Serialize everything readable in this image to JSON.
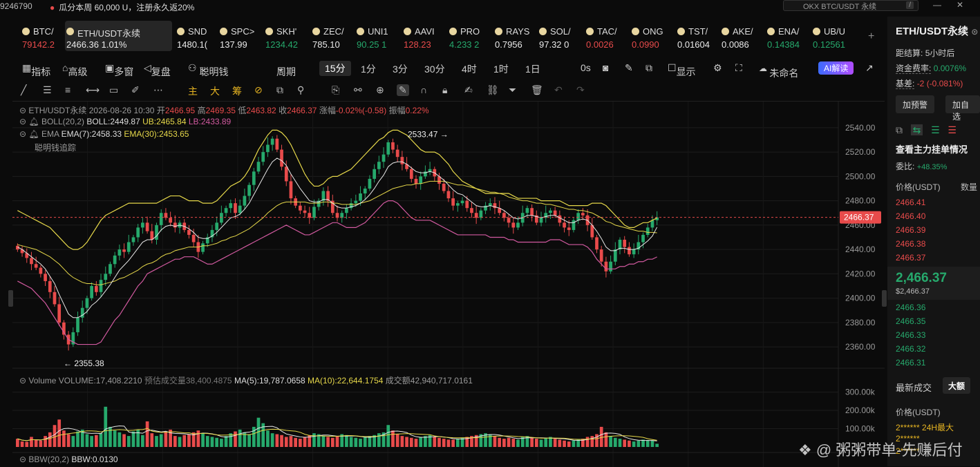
{
  "topbar": {
    "account_fragment": "9246790",
    "promo": "瓜分本周 60,000 U，注册永久返20%",
    "search_placeholder": "OKX BTC/USDT 永续",
    "search_shortcut": "/",
    "window_minimize": "—",
    "window_close": "✕"
  },
  "tickers": [
    {
      "symbol": "BTC/",
      "price": "79142.2",
      "trend": "down"
    },
    {
      "symbol": "ETH/USDT永续",
      "price": "2466.36  1.01%",
      "trend": "neutral",
      "active": true
    },
    {
      "symbol": "SND",
      "price": "1480.1(",
      "trend": "neutral"
    },
    {
      "symbol": "SPC>",
      "price": "137.99",
      "trend": "neutral"
    },
    {
      "symbol": "SKH'",
      "price": "1234.42",
      "trend": "up"
    },
    {
      "symbol": "ZEC/",
      "price": "785.10",
      "trend": "neutral"
    },
    {
      "symbol": "UNI1",
      "price": "90.25  1",
      "trend": "up"
    },
    {
      "symbol": "AAVI",
      "price": "128.23",
      "trend": "down"
    },
    {
      "symbol": "PRO",
      "price": "4.233  2",
      "trend": "up"
    },
    {
      "symbol": "RAYS",
      "price": "0.7956",
      "trend": "neutral"
    },
    {
      "symbol": "SOL/",
      "price": "97.32  0",
      "trend": "neutral"
    },
    {
      "symbol": "TAC/",
      "price": "0.0026",
      "trend": "down"
    },
    {
      "symbol": "ONG",
      "price": "0.0990",
      "trend": "down"
    },
    {
      "symbol": "TST/",
      "price": "0.01604",
      "trend": "neutral"
    },
    {
      "symbol": "AKE/",
      "price": "0.0086",
      "trend": "neutral"
    },
    {
      "symbol": "ENA/",
      "price": "0.14384",
      "trend": "up"
    },
    {
      "symbol": "UB/U",
      "price": "0.12561",
      "trend": "up"
    }
  ],
  "add_ticker": "+",
  "toolbar1": {
    "items": [
      "指标",
      "高级",
      "多窗",
      "复盘",
      "聪明钱",
      "周期"
    ],
    "intervals": [
      "15分",
      "1分",
      "3分",
      "30分",
      "4时",
      "1时",
      "1日"
    ],
    "active_interval": "15分",
    "countdown": "0s",
    "display": "显示",
    "layout_name": "未命名",
    "ai_button": "AI解读"
  },
  "toolbar2": {
    "tags": [
      "主",
      "大",
      "筹"
    ]
  },
  "chart_legend": {
    "symbol_line": "ETH/USDT永续  2026-08-26 10:30",
    "open_label": "开",
    "open": "2466.95",
    "high_label": "高",
    "high": "2469.35",
    "low_label": "低",
    "low": "2463.82",
    "close_label": "收",
    "close": "2466.37",
    "change_label": "涨幅",
    "change": "-0.02%(-0.58)",
    "amplitude_label": "振幅",
    "amplitude": "0.22%",
    "boll_name": "BOLL(20,2)",
    "boll": "BOLL:2449.87",
    "ub": "UB:2465.84",
    "lb": "LB:2433.89",
    "ema_name": "EMA",
    "ema7": "EMA(7):2458.33",
    "ema30": "EMA(30):2453.65",
    "smart_money": "聪明钱追踪"
  },
  "chart_annotations": {
    "high_mark": "2533.47 →",
    "low_mark": "← 2355.38",
    "current_price": "2466.37"
  },
  "volume_legend": {
    "name": "Volume",
    "volume": "VOLUME:17,408.2210",
    "est_label": "预估成交量",
    "est": "38,400.4875",
    "ma5": "MA(5):19,787.0658",
    "ma10": "MA(10):22,644.1754",
    "turnover_label": "成交额",
    "turnover": "42,940,717.0161"
  },
  "bbw_legend": {
    "name": "BBW(20,2)",
    "value": "BBW:0.0130"
  },
  "side": {
    "title": "ETH/USDT永续",
    "settle_label": "距结算:",
    "settle": "5小时后",
    "funding_label": "资金费率:",
    "funding": "0.0076%",
    "basis_label": "基差:",
    "basis": "-2 (-0.081%)",
    "alert_btn": "加预警",
    "fav_btn": "加自选",
    "orderbook_title": "查看主力挂单情况",
    "ratio_label": "委比:",
    "ratio": "+48.35%",
    "price_header": "价格(USDT)",
    "qty_header": "数量",
    "asks": [
      "2466.41",
      "2466.40",
      "2466.39",
      "2466.38",
      "2466.37"
    ],
    "last_price": "2,466.37",
    "last_price_usd": "$2,466.37",
    "bids": [
      "2466.36",
      "2466.35",
      "2466.33",
      "2466.32",
      "2466.31"
    ],
    "trades_title": "最新成交",
    "trades_tab": "大额",
    "trades_price_header": "价格(USDT)",
    "trade_rows": [
      "2****** 24H最大",
      "2******",
      "2******"
    ]
  },
  "watermark": "粥粥带单-先赚后付",
  "chart_data": {
    "type": "candlestick",
    "title": "ETH/USDT永续",
    "interval": "15分",
    "price_axis": {
      "ticks": [
        2540.0,
        2520.0,
        2500.0,
        2480.0,
        2460.0,
        2440.0,
        2420.0,
        2400.0,
        2380.0,
        2360.0
      ],
      "range": [
        2347,
        2549
      ]
    },
    "volume_axis": {
      "ticks": [
        "300.00k",
        "200.00k",
        "100.00k"
      ],
      "range": [
        0,
        340000
      ]
    },
    "high": 2533.47,
    "low": 2355.38,
    "last": 2466.37,
    "closes": [
      2440,
      2437,
      2433,
      2428,
      2425,
      2420,
      2414,
      2405,
      2395,
      2380,
      2370,
      2362,
      2372,
      2384,
      2392,
      2400,
      2410,
      2405,
      2415,
      2420,
      2428,
      2435,
      2440,
      2438,
      2446,
      2450,
      2458,
      2462,
      2455,
      2448,
      2460,
      2470,
      2466,
      2462,
      2458,
      2462,
      2456,
      2452,
      2446,
      2438,
      2445,
      2450,
      2456,
      2462,
      2470,
      2474,
      2478,
      2470,
      2476,
      2484,
      2493,
      2504,
      2512,
      2520,
      2526,
      2531,
      2522,
      2508,
      2496,
      2482,
      2476,
      2472,
      2470,
      2466,
      2475,
      2480,
      2488,
      2480,
      2470,
      2466,
      2470,
      2474,
      2478,
      2480,
      2486,
      2490,
      2498,
      2506,
      2512,
      2518,
      2528,
      2522,
      2516,
      2510,
      2506,
      2498,
      2494,
      2500,
      2504,
      2506,
      2500,
      2494,
      2488,
      2482,
      2476,
      2478,
      2480,
      2474,
      2470,
      2466,
      2472,
      2476,
      2478,
      2474,
      2470,
      2466,
      2462,
      2458,
      2462,
      2470,
      2474,
      2468,
      2462,
      2466,
      2470,
      2472,
      2468,
      2462,
      2458,
      2456,
      2464,
      2470,
      2468,
      2460,
      2450,
      2440,
      2430,
      2422,
      2430,
      2440,
      2448,
      2442,
      2436,
      2440,
      2446,
      2452,
      2458,
      2464,
      2466.37
    ],
    "ema7": [
      2442,
      2440,
      2437,
      2434,
      2431,
      2428,
      2424,
      2418,
      2412,
      2403,
      2395,
      2387,
      2384,
      2384,
      2386,
      2389,
      2394,
      2397,
      2401,
      2406,
      2411,
      2417,
      2423,
      2427,
      2431,
      2436,
      2441,
      2446,
      2448,
      2448,
      2451,
      2456,
      2459,
      2460,
      2459,
      2460,
      2459,
      2457,
      2454,
      2450,
      2449,
      2449,
      2451,
      2454,
      2458,
      2462,
      2466,
      2467,
      2469,
      2473,
      2478,
      2485,
      2492,
      2499,
      2506,
      2512,
      2515,
      2513,
      2509,
      2502,
      2496,
      2490,
      2485,
      2480,
      2479,
      2479,
      2481,
      2481,
      2478,
      2475,
      2474,
      2474,
      2475,
      2476,
      2478,
      2481,
      2485,
      2490,
      2496,
      2501,
      2508,
      2511,
      2512,
      2512,
      2510,
      2507,
      2504,
      2503,
      2503,
      2504,
      2503,
      2500,
      2497,
      2493,
      2489,
      2486,
      2485,
      2482,
      2479,
      2476,
      2475,
      2475,
      2476,
      2475,
      2474,
      2472,
      2469,
      2466,
      2465,
      2466,
      2468,
      2468,
      2467,
      2466,
      2467,
      2468,
      2468,
      2466,
      2464,
      2462,
      2462,
      2464,
      2465,
      2464,
      2460,
      2455,
      2449,
      2442,
      2439,
      2439,
      2441,
      2441,
      2440,
      2440,
      2441,
      2444,
      2447,
      2451,
      2458.33
    ],
    "ema30": [
      2444,
      2443,
      2442,
      2441,
      2440,
      2438,
      2436,
      2434,
      2431,
      2428,
      2424,
      2420,
      2417,
      2415,
      2413,
      2412,
      2412,
      2411,
      2411,
      2412,
      2413,
      2414,
      2416,
      2417,
      2419,
      2421,
      2423,
      2426,
      2428,
      2429,
      2431,
      2434,
      2436,
      2437,
      2439,
      2440,
      2441,
      2442,
      2442,
      2442,
      2443,
      2443,
      2444,
      2445,
      2447,
      2448,
      2450,
      2451,
      2453,
      2455,
      2457,
      2460,
      2463,
      2466,
      2470,
      2473,
      2476,
      2478,
      2479,
      2479,
      2479,
      2479,
      2479,
      2478,
      2478,
      2478,
      2479,
      2479,
      2478,
      2478,
      2477,
      2477,
      2477,
      2477,
      2478,
      2479,
      2480,
      2482,
      2484,
      2486,
      2488,
      2490,
      2491,
      2492,
      2493,
      2493,
      2494,
      2494,
      2495,
      2496,
      2496,
      2496,
      2496,
      2495,
      2494,
      2493,
      2493,
      2492,
      2491,
      2490,
      2489,
      2488,
      2487,
      2487,
      2486,
      2485,
      2483,
      2482,
      2481,
      2480,
      2480,
      2479,
      2478,
      2478,
      2477,
      2477,
      2476,
      2475,
      2474,
      2473,
      2473,
      2472,
      2472,
      2471,
      2470,
      2468,
      2466,
      2463,
      2462,
      2460,
      2459,
      2458,
      2457,
      2456,
      2455,
      2455,
      2454,
      2454,
      2453.65
    ],
    "boll_upper": [
      2472,
      2470,
      2468,
      2466,
      2464,
      2462,
      2460,
      2458,
      2454,
      2450,
      2446,
      2442,
      2440,
      2440,
      2442,
      2446,
      2452,
      2458,
      2464,
      2468,
      2470,
      2472,
      2474,
      2476,
      2478,
      2478,
      2478,
      2478,
      2478,
      2478,
      2478,
      2480,
      2482,
      2484,
      2484,
      2484,
      2482,
      2480,
      2480,
      2480,
      2478,
      2478,
      2478,
      2480,
      2484,
      2488,
      2492,
      2494,
      2496,
      2500,
      2506,
      2514,
      2522,
      2528,
      2534,
      2538,
      2538,
      2536,
      2532,
      2526,
      2518,
      2510,
      2502,
      2496,
      2492,
      2492,
      2494,
      2498,
      2500,
      2500,
      2502,
      2504,
      2506,
      2510,
      2514,
      2518,
      2522,
      2526,
      2530,
      2532,
      2536,
      2538,
      2538,
      2536,
      2534,
      2530,
      2526,
      2522,
      2520,
      2520,
      2520,
      2518,
      2514,
      2510,
      2504,
      2500,
      2496,
      2494,
      2492,
      2490,
      2488,
      2486,
      2486,
      2486,
      2486,
      2486,
      2486,
      2484,
      2482,
      2482,
      2482,
      2482,
      2482,
      2480,
      2480,
      2480,
      2480,
      2480,
      2478,
      2476,
      2476,
      2476,
      2476,
      2476,
      2478,
      2478,
      2478,
      2476,
      2472,
      2468,
      2464,
      2460,
      2458,
      2458,
      2460,
      2462,
      2462,
      2464,
      2465.84
    ],
    "boll_lower": [
      2414,
      2412,
      2410,
      2408,
      2404,
      2400,
      2396,
      2390,
      2384,
      2378,
      2372,
      2366,
      2364,
      2362,
      2362,
      2362,
      2362,
      2362,
      2364,
      2370,
      2376,
      2382,
      2386,
      2392,
      2398,
      2404,
      2410,
      2414,
      2420,
      2422,
      2424,
      2426,
      2428,
      2430,
      2432,
      2432,
      2434,
      2434,
      2434,
      2432,
      2430,
      2428,
      2428,
      2430,
      2432,
      2434,
      2436,
      2438,
      2440,
      2442,
      2444,
      2446,
      2448,
      2450,
      2452,
      2454,
      2456,
      2458,
      2460,
      2458,
      2456,
      2454,
      2452,
      2452,
      2454,
      2456,
      2458,
      2460,
      2462,
      2462,
      2460,
      2458,
      2458,
      2458,
      2460,
      2462,
      2466,
      2470,
      2474,
      2478,
      2480,
      2480,
      2478,
      2474,
      2470,
      2466,
      2464,
      2464,
      2464,
      2464,
      2462,
      2460,
      2458,
      2456,
      2454,
      2452,
      2452,
      2452,
      2452,
      2452,
      2452,
      2452,
      2450,
      2450,
      2450,
      2450,
      2448,
      2448,
      2446,
      2446,
      2446,
      2446,
      2446,
      2446,
      2446,
      2448,
      2448,
      2448,
      2446,
      2444,
      2444,
      2444,
      2444,
      2442,
      2438,
      2432,
      2428,
      2424,
      2424,
      2424,
      2426,
      2426,
      2428,
      2428,
      2430,
      2430,
      2432,
      2432,
      2433.89
    ],
    "volume_k": [
      45,
      30,
      28,
      55,
      40,
      35,
      60,
      80,
      120,
      150,
      90,
      70,
      60,
      85,
      95,
      70,
      60,
      65,
      75,
      220,
      110,
      90,
      80,
      70,
      60,
      85,
      95,
      65,
      140,
      75,
      60,
      70,
      85,
      95,
      60,
      55,
      65,
      70,
      80,
      90,
      75,
      60,
      55,
      50,
      45,
      60,
      75,
      85,
      95,
      80,
      70,
      110,
      160,
      130,
      90,
      75,
      70,
      65,
      55,
      60,
      50,
      45,
      55,
      65,
      75,
      70,
      60,
      55,
      50,
      60,
      70,
      65,
      55,
      50,
      45,
      55,
      60,
      65,
      75,
      80,
      120,
      90,
      70,
      60,
      55,
      50,
      45,
      55,
      60,
      65,
      55,
      50,
      45,
      40,
      40,
      45,
      50,
      55,
      60,
      65,
      70,
      75,
      70,
      60,
      50,
      45,
      50,
      45,
      40,
      55,
      60,
      50,
      45,
      40,
      50,
      55,
      45,
      40,
      35,
      30,
      35,
      40,
      45,
      55,
      60,
      70,
      110,
      80,
      60,
      50,
      45,
      40,
      35,
      30,
      35,
      40,
      38,
      35,
      17.4
    ]
  }
}
